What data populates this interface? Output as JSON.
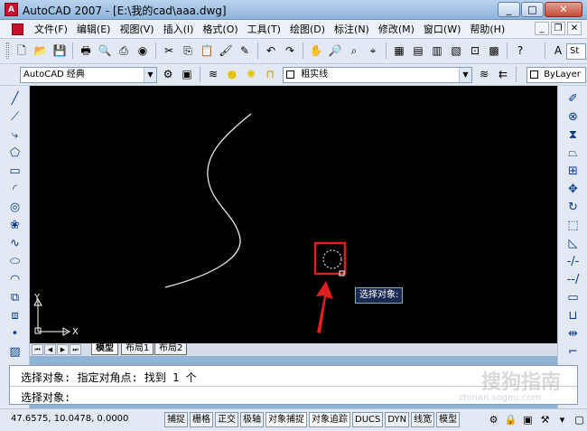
{
  "window": {
    "title": "AutoCAD 2007 - [E:\\我的cad\\aaa.dwg]",
    "minimize": "_",
    "maximize": "□",
    "close": "✕"
  },
  "menu": {
    "items": [
      "文件(F)",
      "编辑(E)",
      "视图(V)",
      "插入(I)",
      "格式(O)",
      "工具(T)",
      "绘图(D)",
      "标注(N)",
      "修改(M)",
      "窗口(W)",
      "帮助(H)"
    ],
    "mdi_minimize": "_",
    "mdi_restore": "❐",
    "mdi_close": "✕"
  },
  "toolbar": {
    "workspace_value": "AutoCAD 经典",
    "layer_value": "粗实线",
    "style_value": "St",
    "linetype_value": "ByLayer"
  },
  "canvas": {
    "ucs_y": "Y",
    "ucs_x": "X",
    "tooltip": "选择对象:"
  },
  "tabs": {
    "items": [
      "模型",
      "布局1",
      "布局2"
    ],
    "active": "模型"
  },
  "command": {
    "line1": "选择对象: 指定对角点: 找到 1 个",
    "line2": "选择对象:",
    "watermark": "搜狗指南",
    "watermark_url": "zhinan.sogou.com"
  },
  "status": {
    "coords": "47.6575, 10.0478, 0.0000",
    "toggles": [
      "捕捉",
      "栅格",
      "正交",
      "极轴",
      "对象捕捉",
      "对象追踪",
      "DUCS",
      "DYN",
      "线宽",
      "模型"
    ]
  },
  "colors": {
    "annotation_red": "#e02020",
    "canvas_bg": "#000000"
  },
  "icons": {
    "left_toolbar": [
      "line-icon",
      "construction-line-icon",
      "polyline-icon",
      "polygon-icon",
      "rectangle-icon",
      "arc-icon",
      "circle-icon",
      "revision-cloud-icon",
      "spline-icon",
      "ellipse-icon",
      "ellipse-arc-icon",
      "insert-block-icon",
      "make-block-icon",
      "point-icon",
      "hatch-icon"
    ],
    "right_toolbar": [
      "erase-icon",
      "copy-icon",
      "mirror-icon",
      "offset-icon",
      "array-icon",
      "move-icon",
      "rotate-icon",
      "scale-icon",
      "stretch-icon",
      "trim-icon",
      "extend-icon",
      "break-icon",
      "join-icon",
      "chamfer-icon",
      "fillet-icon"
    ]
  }
}
